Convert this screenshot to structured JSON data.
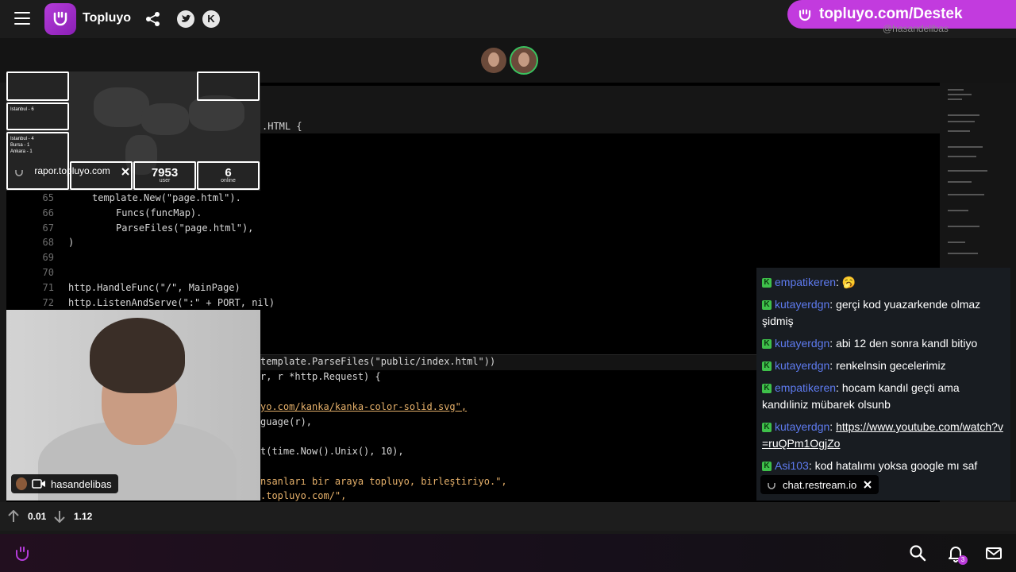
{
  "header": {
    "brand": "Topluyo",
    "destek_text": "topluyo.com/Destek",
    "destek_sub": "@hasandelibas",
    "k_icon_letter": "K"
  },
  "map_overlay": {
    "tile1_text": "Istanbul - 6",
    "tile2_text": "Istanbul - 4\nBursa - 1\nAnkara - 1",
    "rapor": "rapor.topluyo.com",
    "users": "7953",
    "users_label": "user",
    "online": "6",
    "online_label": "online"
  },
  "code": {
    "lines": [
      {
        "n": "65",
        "text": "template.New(\"page.html\")."
      },
      {
        "n": "66",
        "text": "Funcs(funcMap)."
      },
      {
        "n": "67",
        "text": "ParseFiles(\"page.html\"),"
      },
      {
        "n": "68",
        "text": ")"
      },
      {
        "n": "69",
        "text": ""
      },
      {
        "n": "70",
        "text": ""
      },
      {
        "n": "71",
        "text": "http.HandleFunc(\"/\", MainPage)"
      },
      {
        "n": "72",
        "text": "http.ListenAndServe(\":\" + PORT, nil)"
      }
    ],
    "top_fragment": ".HTML {",
    "frag1": "template.ParseFiles(\"public/index.html\"))",
    "frag2": "r, r *http.Request) {",
    "frag3": "yo.com/kanka/kanka-color-solid.svg\",",
    "frag4": "guage(r),",
    "frag5": "t(time.Now().Unix(), 10),",
    "frag6": "nsanları bir araya topluyo, birleştiriyo.\",",
    "frag7": ".topluyo.com/\","
  },
  "webcam": {
    "username": "hasandelibas"
  },
  "chat": {
    "messages": [
      {
        "user": "empatikeren",
        "text": "🥱"
      },
      {
        "user": "kutayerdgn",
        "text": "gerçi kod yuazarkende olmaz şidmiş"
      },
      {
        "user": "kutayerdgn",
        "text": "abi 12 den sonra kandl bitiyo"
      },
      {
        "user": "kutayerdgn",
        "text": "renkelnsin gecelerimiz"
      },
      {
        "user": "empatikeren",
        "text": "hocam kandıl geçti ama kandıliniz mübarek olsunb"
      },
      {
        "user": "kutayerdgn",
        "text": "https://www.youtube.com/watch?v=ruQPm1OgjZo"
      },
      {
        "user": "Asi103",
        "text": "kod hatalımı yoksa google mı saf"
      }
    ],
    "restream": "chat.restream.io"
  },
  "bandwidth": {
    "up": "0.01",
    "down": "1.12"
  },
  "notifications": {
    "count": "3"
  },
  "colors": {
    "accent": "#c23bde",
    "kanka_green": "#3ec04a",
    "username": "#5e7bf0"
  }
}
